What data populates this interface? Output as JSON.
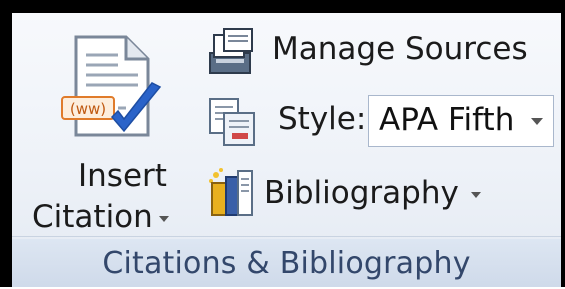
{
  "ribbon_group": {
    "label": "Citations & Bibliography"
  },
  "insert_citation": {
    "line1": "Insert",
    "line2": "Citation",
    "icon": "insert-citation-icon"
  },
  "manage_sources": {
    "label": "Manage Sources",
    "icon": "manage-sources-icon"
  },
  "style": {
    "label": "Style:",
    "selected_value": "APA Fifth",
    "icon": "style-icon"
  },
  "bibliography": {
    "label": "Bibliography",
    "icon": "bibliography-icon"
  },
  "colors": {
    "accent_blue": "#2f6fc4",
    "check_blue": "#2a63c9",
    "text": "#1b1b1b",
    "group_label": "#33476b"
  }
}
